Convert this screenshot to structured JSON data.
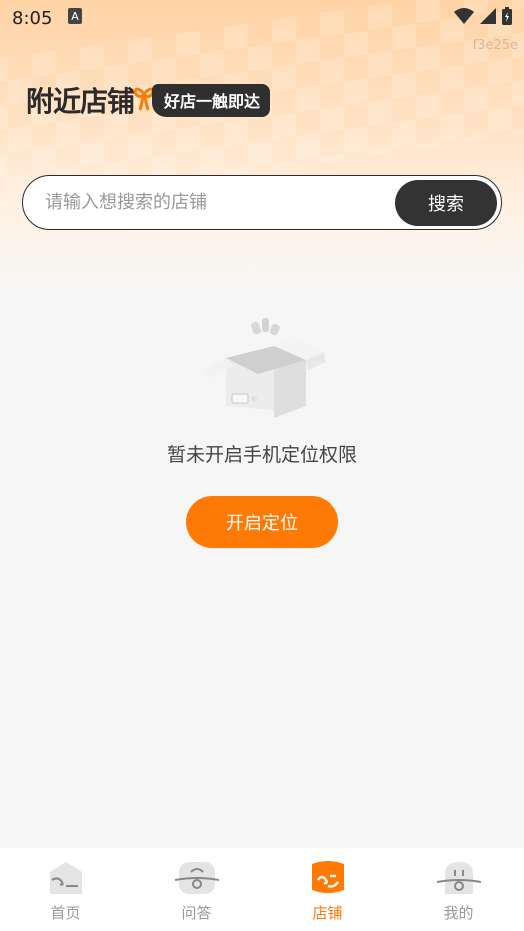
{
  "status_bar": {
    "time": "8:05",
    "build_hash": "f3e25e"
  },
  "header": {
    "title": "附近店铺",
    "slogan": "好店一触即达"
  },
  "search": {
    "placeholder": "请输入想搜索的店铺",
    "button_label": "搜索"
  },
  "empty_state": {
    "message": "暂未开启手机定位权限",
    "action_label": "开启定位"
  },
  "tabs": [
    {
      "label": "首页",
      "icon": "home-icon",
      "active": false
    },
    {
      "label": "问答",
      "icon": "qa-icon",
      "active": false
    },
    {
      "label": "店铺",
      "icon": "store-icon",
      "active": true
    },
    {
      "label": "我的",
      "icon": "profile-icon",
      "active": false
    }
  ],
  "colors": {
    "accent": "#ff7a05",
    "dark": "#333333",
    "background": "#f6f6f6"
  }
}
